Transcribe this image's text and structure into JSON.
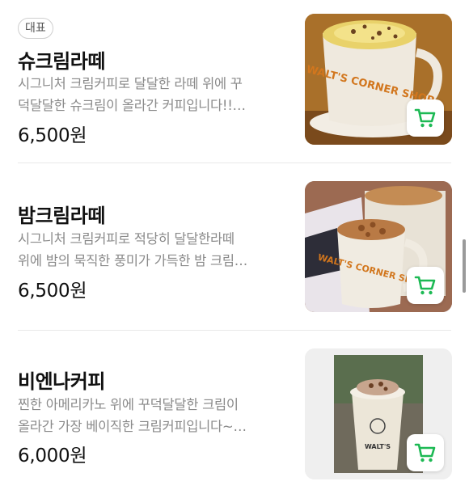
{
  "items": [
    {
      "badge": "대표",
      "name": "슈크림라떼",
      "desc_line1": "시그니처 크림커피로 달달한 라떼 위에 꾸",
      "desc_line2": "덕달달한 슈크림이 올라간 커피입니다!!…",
      "price": "6,500원",
      "thumb_text": "WALT'S CORNER SHOP"
    },
    {
      "name": "밤크림라떼",
      "desc_line1": "시그니처 크림커피로 적당히 달달한라떼",
      "desc_line2": "위에 밤의 묵직한 풍미가 가득한 밤 크림…",
      "price": "6,500원",
      "thumb_text": "WALT'S CORNER SHOP"
    },
    {
      "name": "비엔나커피",
      "desc_line1": "찐한 아메리카노 위에 꾸덕달달한 크림이",
      "desc_line2": "올라간 가장 베이직한 크림커피입니다~…",
      "price": "6,000원",
      "thumb_text": "WALT'S"
    }
  ],
  "colors": {
    "accent": "#1db954",
    "text": "#111111",
    "muted": "#8a8a8a",
    "divider": "#e9e9e9"
  },
  "icons": {
    "cart": "shopping-cart-icon"
  }
}
